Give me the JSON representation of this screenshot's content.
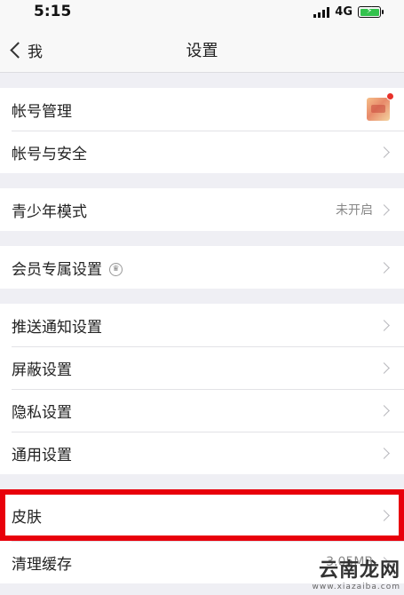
{
  "status_bar": {
    "time": "5:15",
    "network": "4G"
  },
  "nav": {
    "back_label": "我",
    "title": "设置"
  },
  "groups": {
    "account": {
      "items": [
        "帐号管理",
        "帐号与安全"
      ]
    },
    "teen": {
      "label": "青少年模式",
      "value": "未开启"
    },
    "member": {
      "label": "会员专属设置"
    },
    "prefs": {
      "items": [
        "推送通知设置",
        "屏蔽设置",
        "隐私设置",
        "通用设置"
      ]
    },
    "misc": {
      "items": [
        "皮肤",
        "清理缓存"
      ],
      "cache_size": "3.05MB"
    }
  },
  "watermark": {
    "text": "云南龙网",
    "sub": "www.xiazaiba.com"
  },
  "colors": {
    "highlight": "#e8000b",
    "badge": "#e8312a",
    "battery": "#33c24d"
  }
}
